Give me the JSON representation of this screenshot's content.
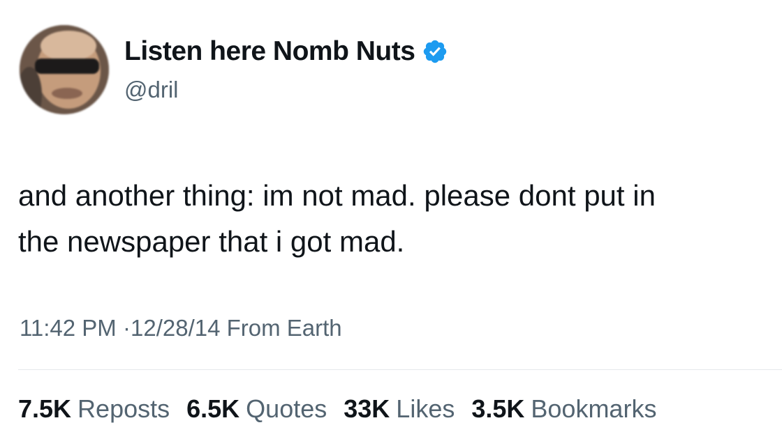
{
  "author": {
    "display_name": "Listen here Nomb Nuts",
    "handle": "@dril",
    "verified": true,
    "avatar_icon": "profile-photo",
    "verified_icon": "verified-badge-icon",
    "verified_color": "#1d9bf0"
  },
  "tweet": {
    "text_lines": [
      "and another thing: im not mad. please dont put in",
      "the newspaper that i got mad."
    ],
    "time": "11:42 PM",
    "separator": "·",
    "date": "12/28/14",
    "source": "From Earth"
  },
  "stats": [
    {
      "count": "7.5K",
      "label": "Reposts"
    },
    {
      "count": "6.5K",
      "label": "Quotes"
    },
    {
      "count": "33K",
      "label": "Likes"
    },
    {
      "count": "3.5K",
      "label": "Bookmarks"
    }
  ],
  "colors": {
    "text_primary": "#0f1419",
    "text_secondary": "#536471",
    "divider": "#e6e9eb"
  }
}
